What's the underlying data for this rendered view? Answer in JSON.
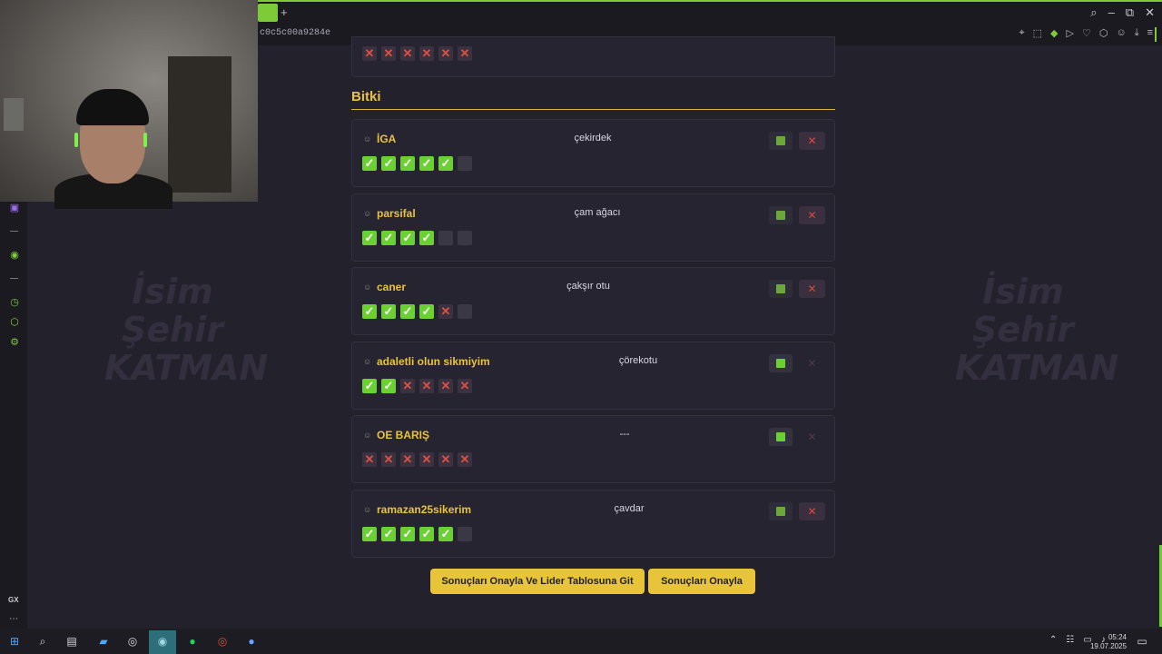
{
  "browser": {
    "url_fragment": "c0c5c00a9284e"
  },
  "section": {
    "title": "Bitki"
  },
  "top_card_marks": [
    "no",
    "no",
    "no",
    "no",
    "no",
    "no"
  ],
  "entries": [
    {
      "name": "İGA",
      "answer": "çekirdek",
      "marks": [
        "ok",
        "ok",
        "ok",
        "ok",
        "ok",
        "empty"
      ],
      "accept_active": false,
      "reject_active": true
    },
    {
      "name": "parsifal",
      "answer": "çam ağacı",
      "marks": [
        "ok",
        "ok",
        "ok",
        "ok",
        "empty",
        "empty"
      ],
      "accept_active": false,
      "reject_active": true
    },
    {
      "name": "caner",
      "answer": "çakşır otu",
      "marks": [
        "ok",
        "ok",
        "ok",
        "ok",
        "no",
        "empty"
      ],
      "accept_active": false,
      "reject_active": true
    },
    {
      "name": "adaletli olun sikmiyim",
      "answer": "çörekotu",
      "marks": [
        "ok",
        "ok",
        "no",
        "no",
        "no",
        "no"
      ],
      "accept_active": true,
      "reject_active": false
    },
    {
      "name": "OE BARIŞ",
      "answer": "---",
      "marks": [
        "no",
        "no",
        "no",
        "no",
        "no",
        "no"
      ],
      "accept_active": true,
      "reject_active": false
    },
    {
      "name": "ramazan25sikerim",
      "answer": "çavdar",
      "marks": [
        "ok",
        "ok",
        "ok",
        "ok",
        "ok",
        "empty"
      ],
      "accept_active": false,
      "reject_active": true
    }
  ],
  "actions": {
    "confirm_and_leaderboard": "Sonuçları Onayla Ve Lider Tablosuna Git",
    "confirm": "Sonuçları Onayla"
  },
  "background_art": {
    "logo_lines": [
      "İsim",
      "Şehir",
      "KATMAN"
    ]
  },
  "sidebar": {
    "badge": "GX"
  },
  "taskbar": {
    "time": "05:24",
    "date": "19.07.2025"
  },
  "colors": {
    "accent": "#e9c43a",
    "ok": "#6bd132",
    "no": "#e05040",
    "background": "#23212c"
  }
}
